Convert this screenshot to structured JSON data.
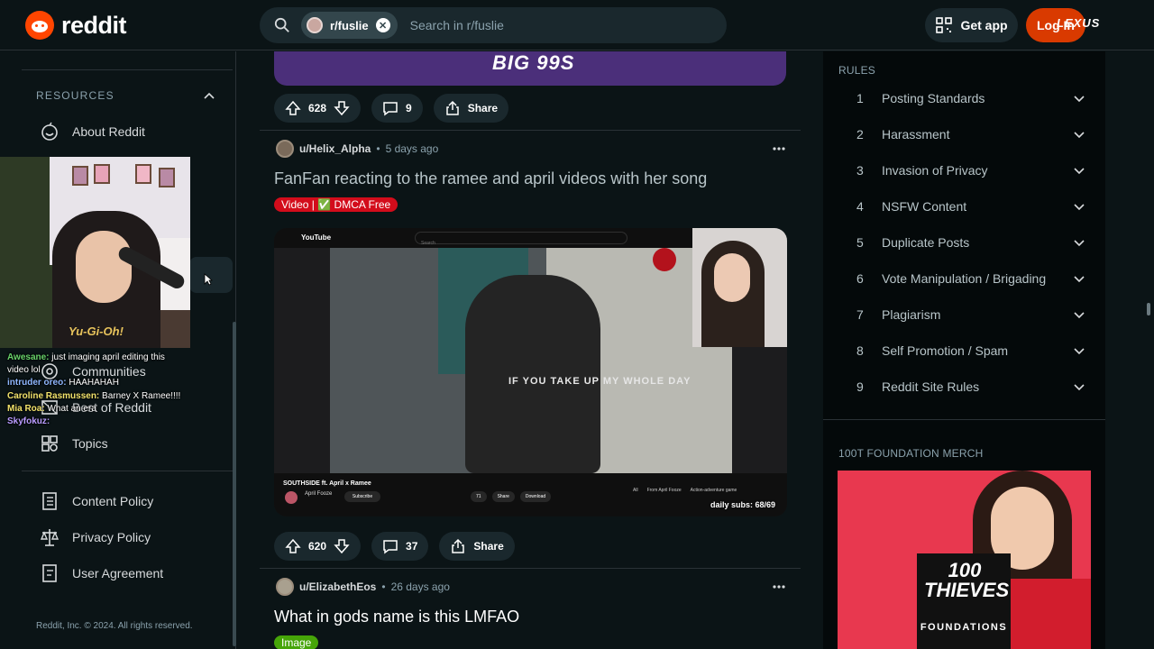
{
  "header": {
    "logo_text": "reddit",
    "search_chip": "r/fuslie",
    "search_placeholder": "Search in r/fuslie",
    "get_app": "Get app",
    "login": "Log In",
    "ad_brand": "LEXUS"
  },
  "left_sidebar": {
    "section_title": "RESOURCES",
    "items": [
      {
        "label": "About Reddit",
        "icon": "smiley-icon"
      },
      {
        "label": "Communities",
        "icon": "communities-icon"
      },
      {
        "label": "Best of Reddit",
        "icon": "best-of-icon"
      },
      {
        "label": "Topics",
        "icon": "topics-icon"
      }
    ],
    "policy_items": [
      {
        "label": "Content Policy",
        "icon": "content-policy-icon"
      },
      {
        "label": "Privacy Policy",
        "icon": "privacy-policy-icon"
      },
      {
        "label": "User Agreement",
        "icon": "user-agreement-icon"
      }
    ],
    "copyright": "Reddit, Inc. © 2024. All rights reserved."
  },
  "stream_overlay": {
    "shirt_text": "Yu-Gi-Oh!",
    "chat": [
      {
        "name": "Awesane:",
        "text": "just imaging april editing this video lol",
        "color": "#69d36a"
      },
      {
        "name": "intruder oreo:",
        "text": "HAAHAHAH",
        "color": "#8fb7ff"
      },
      {
        "name": "Caroline Rasmussen:",
        "text": "Barney X Ramee!!!!",
        "color": "#f2e36c"
      },
      {
        "name": "Mia Roa:",
        "text": "What an era",
        "color": "#f2e36c"
      },
      {
        "name": "Skyfokuz:",
        "text": "",
        "color": "#b99cff"
      }
    ]
  },
  "feed": {
    "top_media_text": "BIG 99S",
    "posts": [
      {
        "upvotes": "628",
        "comments": "9",
        "share": "Share"
      },
      {
        "author": "u/Helix_Alpha",
        "time": "5 days ago",
        "title": "FanFan reacting to the ramee and april videos with her song",
        "flair": "Video | ✅ DMCA Free",
        "upvotes": "620",
        "comments": "37",
        "share": "Share",
        "video": {
          "yt_logo": "YouTube",
          "yt_search": "Search",
          "caption": "IF YOU TAKE UP MY WHOLE DAY",
          "video_title": "SOUTHSIDE ft. April x Ramee",
          "channel": "April Fooze",
          "subscribe": "Subscribe",
          "likes": "71",
          "share": "Share",
          "download": "Download",
          "tabs": [
            "All",
            "From April Fooze",
            "Action-adventure game"
          ],
          "daily_subs": "daily subs: 68/69"
        }
      },
      {
        "author": "u/ElizabethEos",
        "time": "26 days ago",
        "title": "What in gods name is this LMFAO",
        "flair": "Image"
      }
    ]
  },
  "right_sidebar": {
    "rules_heading": "RULES",
    "rules": [
      {
        "num": "1",
        "text": "Posting Standards"
      },
      {
        "num": "2",
        "text": "Harassment"
      },
      {
        "num": "3",
        "text": "Invasion of Privacy"
      },
      {
        "num": "4",
        "text": "NSFW Content"
      },
      {
        "num": "5",
        "text": "Duplicate Posts"
      },
      {
        "num": "6",
        "text": "Vote Manipulation / Brigading"
      },
      {
        "num": "7",
        "text": "Plagiarism"
      },
      {
        "num": "8",
        "text": "Self Promotion / Spam"
      },
      {
        "num": "9",
        "text": "Reddit Site Rules"
      }
    ],
    "merch_heading": "100T FOUNDATION MERCH",
    "merch_logo": "100 THIEVES",
    "merch_sub": "FOUNDATIONS"
  },
  "colors": {
    "background": "#0b1416",
    "accent": "#ff4500",
    "login": "#d93a00",
    "flair_video": "#d30c1b",
    "flair_image": "#46a508"
  }
}
